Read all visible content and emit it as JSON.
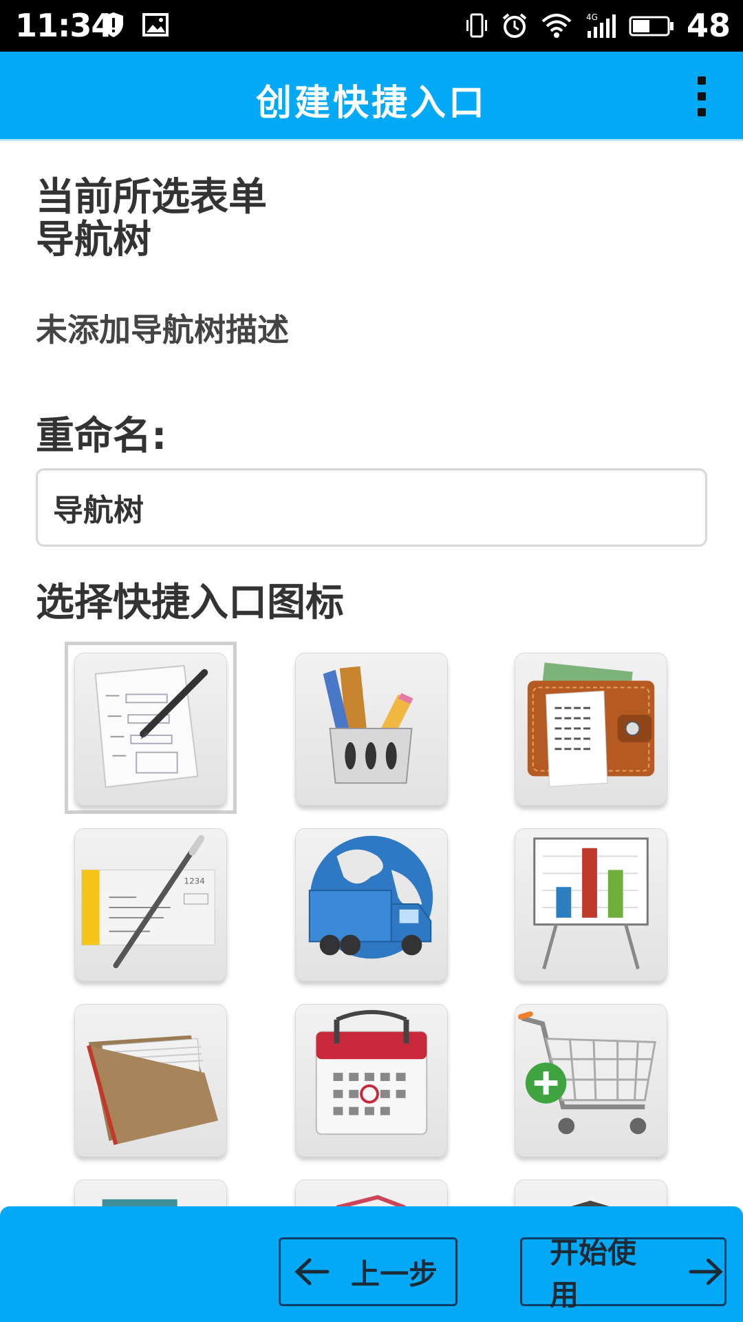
{
  "status_bar": {
    "time": "11:34",
    "battery_level": "48",
    "icons_left": [
      "shield-icon",
      "image-icon"
    ],
    "icons_right": [
      "vibrate-icon",
      "alarm-icon",
      "wifi-icon",
      "signal-4g-icon",
      "battery-icon"
    ]
  },
  "app_bar": {
    "title": "创建快捷入口",
    "menu_icon": "more-vertical-icon"
  },
  "main": {
    "current_form_label": "当前所选表单",
    "current_form_name": "导航树",
    "description": "未添加导航树描述",
    "rename_label": "重命名:",
    "rename_value": "导航树",
    "icon_section_label": "选择快捷入口图标",
    "icons": [
      {
        "name": "form-pen-icon",
        "selected": true
      },
      {
        "name": "stationery-cup-icon",
        "selected": false
      },
      {
        "name": "wallet-icon",
        "selected": false
      },
      {
        "name": "check-pen-icon",
        "selected": false
      },
      {
        "name": "globe-truck-icon",
        "selected": false
      },
      {
        "name": "chart-easel-icon",
        "selected": false
      },
      {
        "name": "file-folder-icon",
        "selected": false
      },
      {
        "name": "calendar-icon",
        "selected": false
      },
      {
        "name": "shopping-cart-add-icon",
        "selected": false
      }
    ]
  },
  "bottom_bar": {
    "prev_label": "上一步",
    "next_label": "开始使用"
  },
  "colors": {
    "accent": "#03a9f4",
    "status_bar": "#000000",
    "button_border": "#0b3c64"
  }
}
